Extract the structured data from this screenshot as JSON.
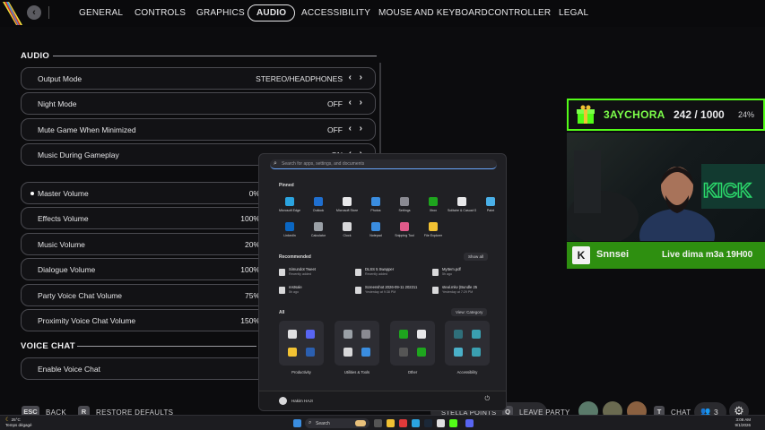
{
  "nav": {
    "tabs": [
      "GENERAL",
      "CONTROLS",
      "GRAPHICS",
      "AUDIO",
      "ACCESSIBILITY",
      "MOUSE AND KEYBOARD",
      "CONTROLLER",
      "LEGAL"
    ],
    "active_tab": "AUDIO"
  },
  "audio": {
    "title": "AUDIO",
    "rows": [
      {
        "label": "Output Mode",
        "value": "STEREO/HEADPHONES"
      },
      {
        "label": "Night Mode",
        "value": "OFF"
      },
      {
        "label": "Mute Game When Minimized",
        "value": "OFF"
      },
      {
        "label": "Music During Gameplay",
        "value": "ON"
      }
    ],
    "volume_rows": [
      {
        "label": "Master Volume",
        "value": "0%"
      },
      {
        "label": "Effects Volume",
        "value": "100%"
      },
      {
        "label": "Music Volume",
        "value": "20%"
      },
      {
        "label": "Dialogue Volume",
        "value": "100%"
      },
      {
        "label": "Party Voice Chat Volume",
        "value": "75%"
      },
      {
        "label": "Proximity Voice Chat Volume",
        "value": "150%"
      }
    ]
  },
  "voice_chat": {
    "title": "VOICE CHAT",
    "rows": [
      {
        "label": "Enable Voice Chat",
        "value": ""
      }
    ]
  },
  "hints": {
    "back_key": "ESC",
    "back_label": "BACK",
    "restore_key": "R",
    "restore_label": "RESTORE DEFAULTS",
    "stellar_label": "STELLA POINTS",
    "leave_key": "Q",
    "leave_label": "LEAVE PARTY",
    "chat_key": "T",
    "chat_label": "CHAT",
    "party_count": "3"
  },
  "start_menu": {
    "search_placeholder": "Search for apps, settings, and documents",
    "pinned_label": "Pinned",
    "pinned": [
      {
        "name": "Microsoft Edge",
        "color": "#2ba4e0"
      },
      {
        "name": "Outlook",
        "color": "#1f6fd0"
      },
      {
        "name": "Microsoft Store",
        "color": "#e8e8ea"
      },
      {
        "name": "Photos",
        "color": "#3a8de0"
      },
      {
        "name": "Settings",
        "color": "#8a8a92"
      },
      {
        "name": "Xbox",
        "color": "#1ea51e"
      },
      {
        "name": "Solitaire & Casual Games",
        "color": "#e8e8ea"
      },
      {
        "name": "Paint",
        "color": "#4ab0e8"
      },
      {
        "name": "LinkedIn",
        "color": "#0a66c2"
      },
      {
        "name": "Calculator",
        "color": "#9aa0a6"
      },
      {
        "name": "Clock",
        "color": "#d8d8da"
      },
      {
        "name": "Notepad",
        "color": "#3a8de0"
      },
      {
        "name": "Snipping Tool",
        "color": "#e05a8a"
      },
      {
        "name": "File Explorer",
        "color": "#f2c233"
      }
    ],
    "recommended_label": "Recommended",
    "show_all": "Show all",
    "recommended": [
      {
        "name": "Simundot Tweet",
        "sub": "Recently added"
      },
      {
        "name": "DLSS 5 Swapper",
        "sub": "Recently added"
      },
      {
        "name": "MyItem.pdf",
        "sub": "5h ago"
      },
      {
        "name": "restsale",
        "sub": "5h ago"
      },
      {
        "name": "Screenshot 2026-09-11 202211",
        "sub": "Yesterday at 9:38 PM"
      },
      {
        "name": "steal.mkv (Bundle 25",
        "sub": "Yesterday at 7:29 PM"
      }
    ],
    "all_label": "All",
    "view_category": "View: Category",
    "categories": [
      "Productivity",
      "Utilities & Tools",
      "Other",
      "Accessibility"
    ],
    "user_name": "Hakim HAJI"
  },
  "stream": {
    "sub_name": "3AYCHORA",
    "sub_count": "242 / 1000",
    "sub_pct": "24%",
    "banner_name": "Snnsei",
    "banner_msg": "Live dima m3a 19H00",
    "brand_color": "#53fc18"
  },
  "taskbar": {
    "weather_temp": "25°C",
    "weather_desc": "Temps dégagé",
    "search_label": "Search",
    "time": "3:08 AM",
    "date": "9/1/2026"
  }
}
